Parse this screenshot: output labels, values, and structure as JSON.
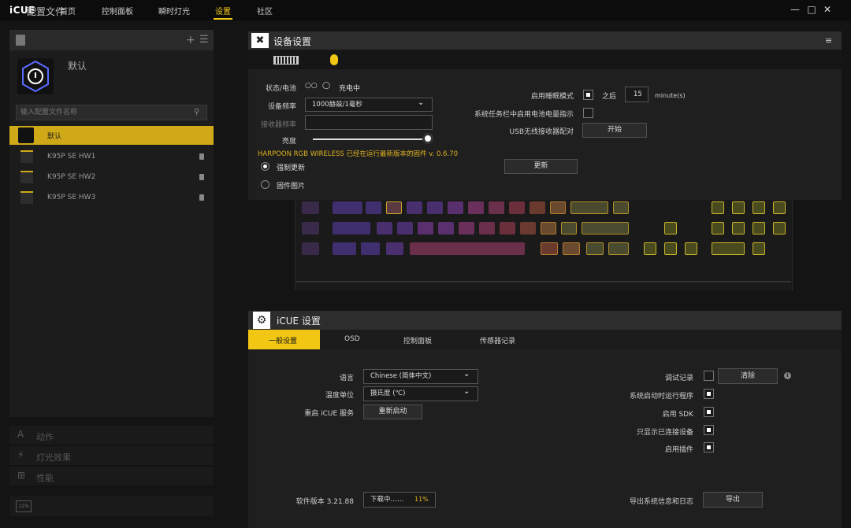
{
  "topbar": {
    "logo": "iCUE",
    "tabs": [
      {
        "label": "首页"
      },
      {
        "label": "控制面板"
      },
      {
        "label": "瞬时灯光"
      },
      {
        "label": "设置"
      },
      {
        "label": "社区"
      }
    ],
    "active_tab": "设置",
    "window_controls": [
      "minimize-icon",
      "maximize-icon",
      "close-icon"
    ]
  },
  "sidebar": {
    "profiles_title": "配置文件",
    "current_profile": "默认",
    "search_placeholder": "输入配置文件名称",
    "profiles": [
      {
        "label": "默认",
        "active": true
      },
      {
        "label": "K95P SE HW1",
        "active": false
      },
      {
        "label": "K95P SE HW2",
        "active": false
      },
      {
        "label": "K95P SE HW3",
        "active": false
      }
    ],
    "sections": [
      {
        "icon": "A",
        "label": "动作"
      },
      {
        "icon": "⚡",
        "label": "灯光效果"
      },
      {
        "icon": "⊞",
        "label": "性能"
      }
    ],
    "footer_icon": "11%"
  },
  "device": {
    "title": "设备设置",
    "status_label": "状态/电池",
    "status_value": "充电中",
    "rate_label": "设备频率",
    "rate_value": "1000赫兹/1毫秒",
    "receiver_label": "接收器频率",
    "receiver_value": "",
    "brightness_label": "亮度",
    "brightness_level": 1.0,
    "firmware_notice": "HARPOON RGB WIRELESS 已经在运行最新版本的固件 v. 0.6.70",
    "force_update": "强制更新",
    "firmware_image": "固件图片",
    "update_button": "更新",
    "sleep_label": "启用睡眠模式",
    "sleep_after": "之后",
    "sleep_value": "15",
    "sleep_unit": "minute(s)",
    "tray_battery_label": "系统任务栏中启用电池电量指示",
    "usb_pair_label": "USB无线接收器配对",
    "usb_pair_button": "开始"
  },
  "icue": {
    "title": "iCUE 设置",
    "tabs": [
      {
        "label": "一般设置"
      },
      {
        "label": "OSD"
      },
      {
        "label": "控制面板"
      },
      {
        "label": "传感器记录"
      }
    ],
    "language_label": "语言",
    "language_value": "Chinese (简体中文)",
    "temp_label": "温度单位",
    "temp_value": "摄氏度 (℃)",
    "restart_label": "重启 iCUE 服务",
    "restart_button": "重新启动",
    "version_label": "软件版本 3.21.88",
    "download_label": "下载中……",
    "download_pct": "11%",
    "debug_label": "调试记录",
    "clear_button": "清除",
    "startup_label": "系统启动时运行程序",
    "sdk_label": "启用 SDK",
    "connected_only_label": "只显示已连接设备",
    "plugins_label": "启用插件",
    "export_label": "导出系统信息和日志",
    "export_button": "导出"
  },
  "colors": {
    "accent": "#f2c714",
    "profile_active": "#d0a919",
    "firmware_text": "#e0b320"
  }
}
